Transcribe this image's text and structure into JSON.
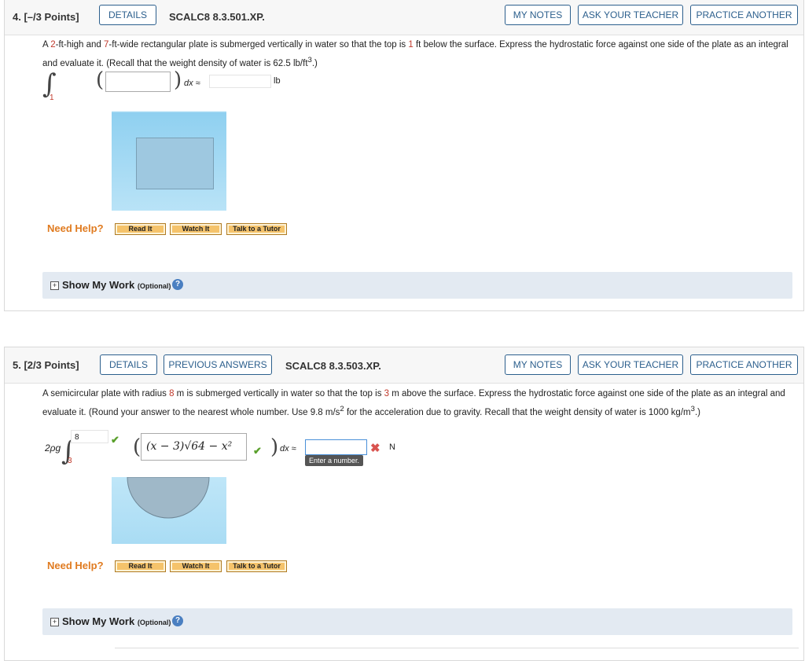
{
  "q4": {
    "number": "4. [–/3 Points]",
    "buttons": {
      "details": "DETAILS",
      "my_notes": "MY NOTES",
      "ask_teacher": "ASK YOUR TEACHER",
      "practice": "PRACTICE ANOTHER"
    },
    "code": "SCALC8 8.3.501.XP.",
    "text": {
      "p1": "A ",
      "height": "2",
      "p2": "-ft-high and ",
      "width": "7",
      "p3": "-ft-wide rectangular plate is submerged vertically in water so that the top is ",
      "depth": "1",
      "p4": " ft below the surface. Express the hydrostatic force against one side of the plate as an integral and evaluate it. (Recall that the weight density of water is 62.5 lb/ft",
      "sup": "3",
      "p5": ".)"
    },
    "math": {
      "lower_limit": "1",
      "upper_limit": "",
      "integrand": "",
      "dx": "dx ≈",
      "answer": "",
      "unit": "lb"
    },
    "help": {
      "label": "Need Help?",
      "read": "Read It",
      "watch": "Watch It",
      "tutor": "Talk to a Tutor"
    },
    "show_work": {
      "title": "Show My Work",
      "optional": "(Optional)"
    }
  },
  "q5": {
    "number": "5. [2/3 Points]",
    "buttons": {
      "details": "DETAILS",
      "previous": "PREVIOUS ANSWERS",
      "my_notes": "MY NOTES",
      "ask_teacher": "ASK YOUR TEACHER",
      "practice": "PRACTICE ANOTHER"
    },
    "code": "SCALC8 8.3.503.XP.",
    "text": {
      "p1": "A semicircular plate with radius ",
      "radius": "8",
      "p2": " m is submerged vertically in water so that the top is ",
      "depth": "3",
      "p3": " m above the surface. Express the hydrostatic force against one side of the plate as an integral and evaluate it. (Round your answer to the nearest whole number. Use 9.8 m/s",
      "sup1": "2",
      "p4": " for the acceleration due to gravity. Recall that the weight density of water is 1000 kg/m",
      "sup2": "3",
      "p5": ".)"
    },
    "math": {
      "coef": "2ρg",
      "upper_limit": "8",
      "lower_limit": "3",
      "integrand": "(x − 3)√64 − x²",
      "dx": "dx ≈",
      "answer": "",
      "unit": "N",
      "tooltip": "Enter a number."
    },
    "help": {
      "label": "Need Help?",
      "read": "Read It",
      "watch": "Watch It",
      "tutor": "Talk to a Tutor"
    },
    "show_work": {
      "title": "Show My Work",
      "optional": "(Optional)"
    }
  },
  "colors": {
    "button_border": "#2c5f8d",
    "highlight_red": "#c0392b",
    "help_orange": "#e07b20",
    "water_blue": "#8fd0f0",
    "check_green": "#5aa02c",
    "error_red": "#d9534f"
  }
}
